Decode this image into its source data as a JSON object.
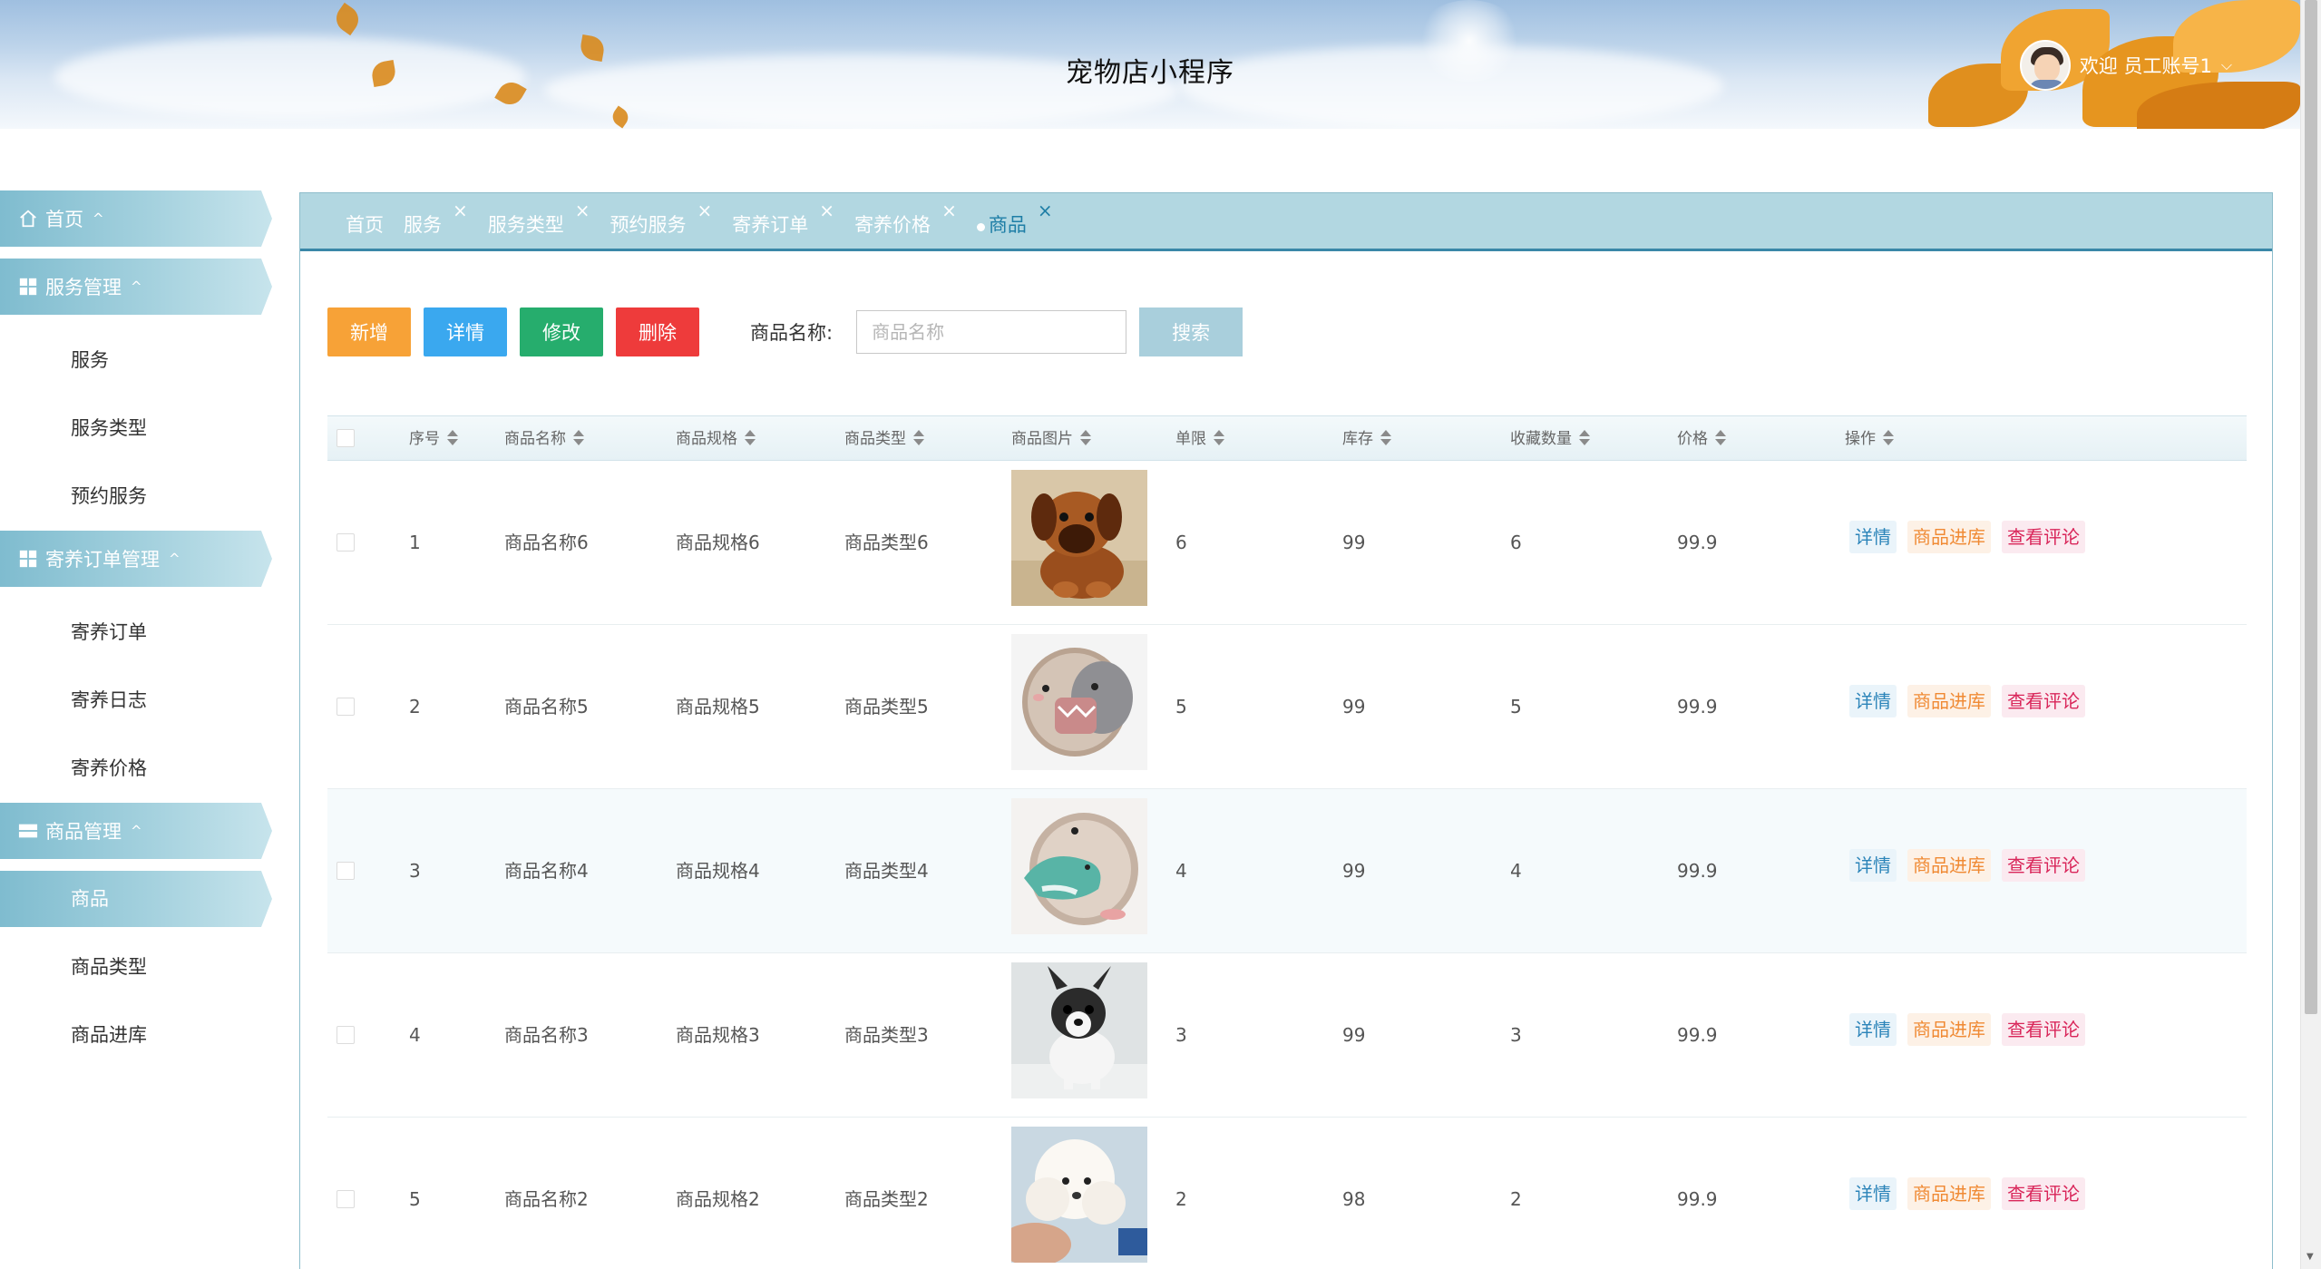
{
  "header": {
    "title": "宠物店小程序",
    "welcome": "欢迎 员工账号1"
  },
  "sidebar": {
    "groups": [
      {
        "label": "首页",
        "icon": "home-icon",
        "items": []
      },
      {
        "label": "服务管理",
        "icon": "grid-icon",
        "items": [
          "服务",
          "服务类型",
          "预约服务"
        ]
      },
      {
        "label": "寄养订单管理",
        "icon": "grid-icon",
        "items": [
          "寄养订单",
          "寄养日志",
          "寄养价格"
        ]
      },
      {
        "label": "商品管理",
        "icon": "list-icon",
        "items": [
          "商品",
          "商品类型",
          "商品进库"
        ]
      }
    ],
    "active_item": "商品"
  },
  "tabs": [
    {
      "label": "首页",
      "closable": false
    },
    {
      "label": "服务",
      "closable": true
    },
    {
      "label": "服务类型",
      "closable": true
    },
    {
      "label": "预约服务",
      "closable": true
    },
    {
      "label": "寄养订单",
      "closable": true
    },
    {
      "label": "寄养价格",
      "closable": true
    },
    {
      "label": "商品",
      "closable": true,
      "active": true
    }
  ],
  "toolbar": {
    "add_label": "新增",
    "detail_label": "详情",
    "edit_label": "修改",
    "delete_label": "删除",
    "search_label": "商品名称:",
    "search_placeholder": "商品名称",
    "search_button": "搜索"
  },
  "table": {
    "columns": [
      "序号",
      "商品名称",
      "商品规格",
      "商品类型",
      "商品图片",
      "单限",
      "库存",
      "收藏数量",
      "价格",
      "操作"
    ],
    "rows": [
      {
        "index": "1",
        "name": "商品名称6",
        "spec": "商品规格6",
        "type": "商品类型6",
        "image": "brown-puppy",
        "limit": "6",
        "stock": "99",
        "favorites": "6",
        "price": "99.9"
      },
      {
        "index": "2",
        "name": "商品名称5",
        "spec": "商品规格5",
        "type": "商品类型5",
        "image": "hedgehog-with-toy",
        "limit": "5",
        "stock": "99",
        "favorites": "5",
        "price": "99.9"
      },
      {
        "index": "3",
        "name": "商品名称4",
        "spec": "商品规格4",
        "type": "商品类型4",
        "image": "hedgehog-with-dino",
        "limit": "4",
        "stock": "99",
        "favorites": "4",
        "price": "99.9"
      },
      {
        "index": "4",
        "name": "商品名称3",
        "spec": "商品规格3",
        "type": "商品类型3",
        "image": "chihuahua-puppy",
        "limit": "3",
        "stock": "99",
        "favorites": "3",
        "price": "99.9"
      },
      {
        "index": "5",
        "name": "商品名称2",
        "spec": "商品规格2",
        "type": "商品类型2",
        "image": "white-poodle",
        "limit": "2",
        "stock": "98",
        "favorites": "2",
        "price": "99.9"
      }
    ],
    "actions": [
      "详情",
      "商品进库",
      "查看评论"
    ]
  },
  "colors": {
    "accent": "#3a87a8",
    "sidebar_active": "#8cc4d4",
    "add": "#f7a237",
    "detail": "#3aa8ef",
    "edit": "#26ad6d",
    "delete": "#ee3b3b"
  }
}
